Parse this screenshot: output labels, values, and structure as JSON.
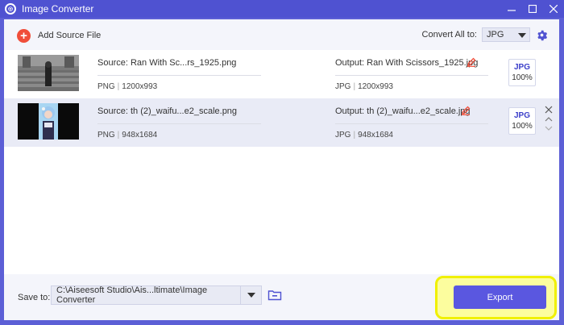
{
  "window": {
    "title": "Image Converter",
    "icon": "aiseesoft-logo-icon"
  },
  "toolbar": {
    "add_label": "Add Source File",
    "convert_all_label": "Convert All to:",
    "format_value": "JPG"
  },
  "files": [
    {
      "source": "Source: Ran With Sc...rs_1925.png",
      "src_format": "PNG",
      "src_size": "1200x993",
      "output": "Output: Ran With Scissors_1925.jpg",
      "out_format": "JPG",
      "out_size": "1200x993",
      "badge_format": "JPG",
      "badge_quality": "100%"
    },
    {
      "source": "Source: th (2)_waifu...e2_scale.png",
      "src_format": "PNG",
      "src_size": "948x1684",
      "output": "Output: th (2)_waifu...e2_scale.jpg",
      "out_format": "JPG",
      "out_size": "948x1684",
      "badge_format": "JPG",
      "badge_quality": "100%"
    }
  ],
  "bottom": {
    "save_label": "Save to:",
    "path": "C:\\Aiseesoft Studio\\Ais...ltimate\\Image Converter",
    "export_label": "Export"
  },
  "colors": {
    "accent": "#4f52d1",
    "add_red": "#f04e3a",
    "export_bg": "#5a57e0",
    "highlight_yellow": "#f0f000"
  }
}
